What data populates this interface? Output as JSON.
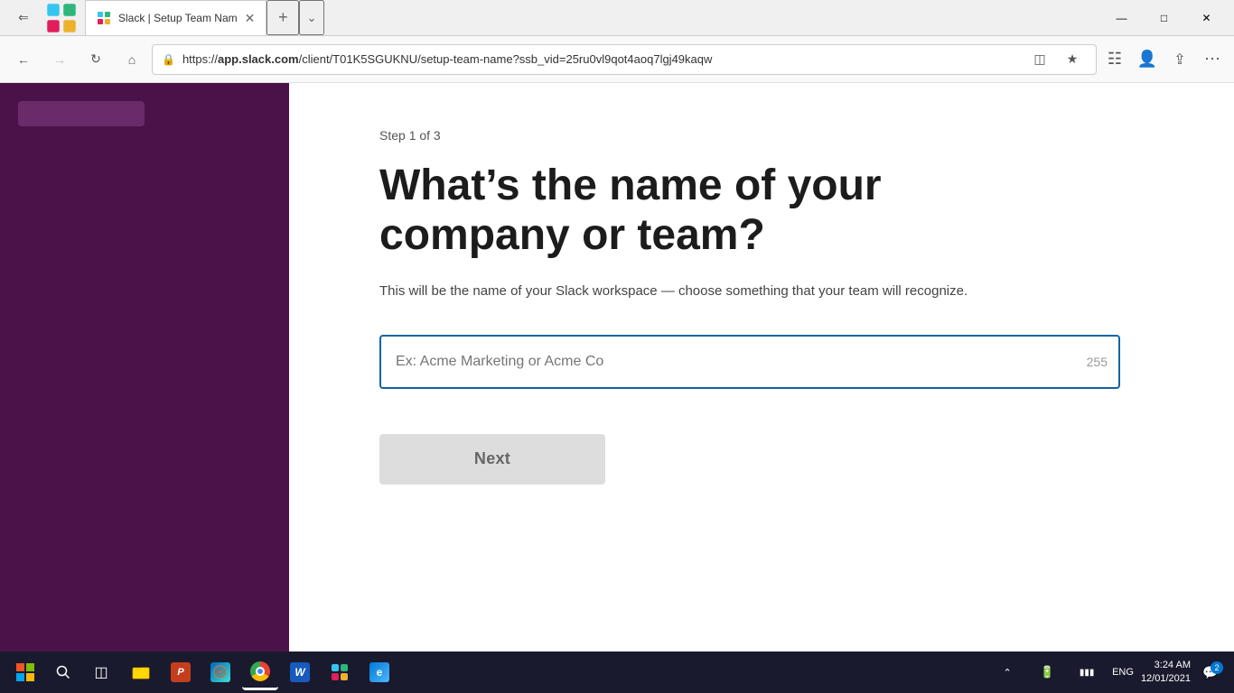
{
  "browser": {
    "tab": {
      "title": "Slack | Setup Team Nam",
      "url_display": "https://app.slack.com/client/T01K5SGUKNU/setup-team-name?ssb_vid=25ru0vl9qot4aoq7lgj49kaqw",
      "url_bold_part": "app.slack.com",
      "url_rest": "/client/T01K5SGUKNU/setup-team-name?ssb_vid=25ru0vl9qot4aoq7lgj49kaqw"
    },
    "nav": {
      "back_disabled": false,
      "forward_disabled": false
    },
    "window_controls": {
      "minimize": "—",
      "maximize": "□",
      "close": "✕"
    }
  },
  "page": {
    "step_label": "Step 1 of 3",
    "heading_line1": "What’s the name of your",
    "heading_line2": "company or team?",
    "description": "This will be the name of your Slack workspace — choose something that your team will recognize.",
    "input": {
      "placeholder": "Ex: Acme Marketing or Acme Co",
      "value": "",
      "char_count": "255"
    },
    "next_button": "Next"
  },
  "taskbar": {
    "time": "3:24 AM",
    "date": "12/01/2021",
    "lang": "ENG",
    "notification_count": "2"
  }
}
